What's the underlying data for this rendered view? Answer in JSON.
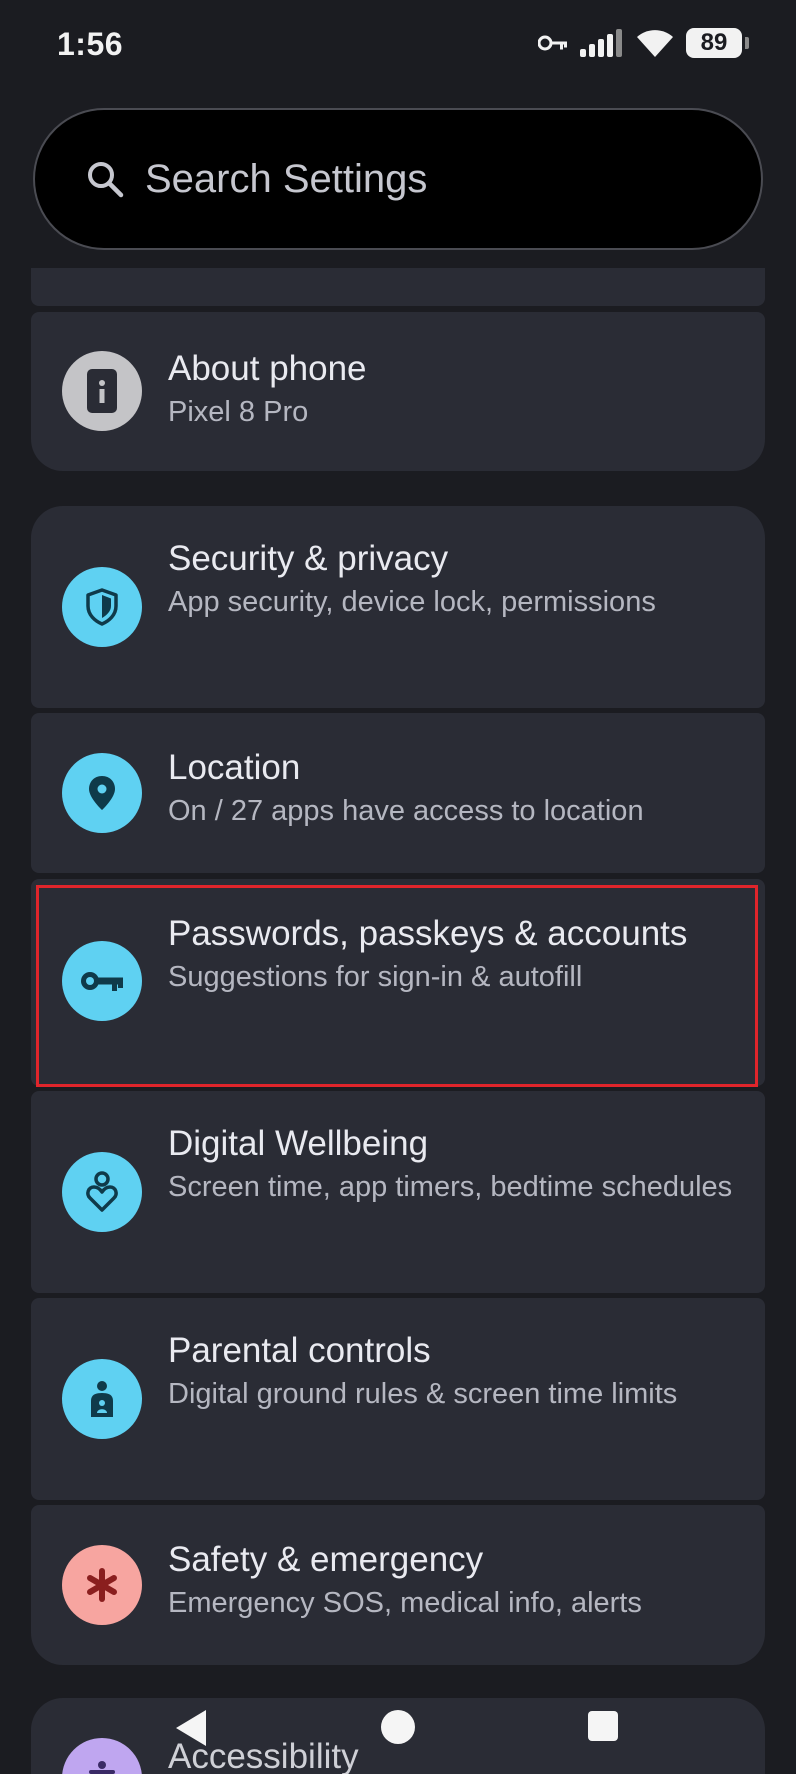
{
  "status": {
    "time": "1:56",
    "battery": "89"
  },
  "search": {
    "placeholder": "Search Settings"
  },
  "items": [
    {
      "title": "About phone",
      "subtitle": "Pixel 8 Pro",
      "icon": "info-phone-icon"
    },
    {
      "title": "Security & privacy",
      "subtitle": "App security, device lock, permissions",
      "icon": "shield-icon"
    },
    {
      "title": "Location",
      "subtitle": "On / 27 apps have access to location",
      "icon": "location-pin-icon"
    },
    {
      "title": "Passwords, passkeys & accounts",
      "subtitle": "Suggestions for sign-in & autofill",
      "icon": "key-icon"
    },
    {
      "title": "Digital Wellbeing",
      "subtitle": "Screen time, app timers, bedtime schedules",
      "icon": "wellbeing-heart-icon"
    },
    {
      "title": "Parental controls",
      "subtitle": "Digital ground rules & screen time limits",
      "icon": "parental-icon"
    },
    {
      "title": "Safety & emergency",
      "subtitle": "Emergency SOS, medical info, alerts",
      "icon": "emergency-asterisk-icon"
    },
    {
      "title": "Accessibility",
      "subtitle": "",
      "icon": "accessibility-icon"
    }
  ],
  "colors": {
    "accent_blue": "#5fd1f2",
    "emergency_pink": "#f7a5a0",
    "accessibility_purple": "#bfa6f0",
    "highlight_red": "#e0252b"
  }
}
